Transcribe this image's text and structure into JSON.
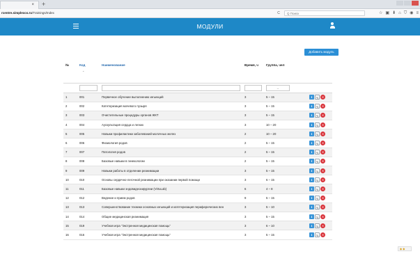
{
  "browser": {
    "tab_label": "",
    "tab_close": "×",
    "new_tab": "+",
    "url_host": "rcentre.simplexcs.ru",
    "url_path": "/Trainings/Index",
    "reload": "С",
    "search_placeholder": "Q Поиск",
    "toolbar_icons": [
      "star-icon",
      "clipboard-icon",
      "download-icon",
      "home-icon",
      "shield-icon",
      "circle-icon",
      "menu-icon"
    ]
  },
  "header": {
    "title": "МОДУЛИ",
    "menu_icon": "hamburger-icon",
    "user_icon": "user-icon"
  },
  "colors": {
    "header_bg": "#1e88c7",
    "button_bg": "#2b8fd6",
    "danger": "#d9353c",
    "link": "#2a6db0"
  },
  "add_button": {
    "label": "Добавить модуль"
  },
  "table": {
    "headers": {
      "num": "№",
      "code": "Код",
      "name": "Наименование",
      "hours": "Время, ч",
      "group": "Группа, чел"
    },
    "sort_caret": "⌄",
    "group_filter_value": "--",
    "action_buttons": [
      "ℹ",
      "✎",
      "✕"
    ],
    "rows": [
      {
        "num": "1",
        "code": "001",
        "name": "Первичное обучение выполнению инъекций",
        "hours": "3",
        "group": "5 – 15"
      },
      {
        "num": "2",
        "code": "002",
        "name": "Катетеризация мочевого пузыря",
        "hours": "3",
        "group": "5 – 15"
      },
      {
        "num": "3",
        "code": "003",
        "name": "Очистительные процедуры органов ЖКТ",
        "hours": "3",
        "group": "5 – 15"
      },
      {
        "num": "4",
        "code": "004",
        "name": "Аускультация сердца и легких",
        "hours": "3",
        "group": "10 – 20"
      },
      {
        "num": "5",
        "code": "005",
        "name": "Навыки профилактики заболеваний молочных желез",
        "hours": "2",
        "group": "10 – 20"
      },
      {
        "num": "6",
        "code": "006",
        "name": "Физиология родов",
        "hours": "2",
        "group": "5 – 15"
      },
      {
        "num": "7",
        "code": "007",
        "name": "Патология родов",
        "hours": "2",
        "group": "5 – 15"
      },
      {
        "num": "8",
        "code": "008",
        "name": "Базовые навыки в гинекологии",
        "hours": "2",
        "group": "5 – 15"
      },
      {
        "num": "9",
        "code": "009",
        "name": "Навыки работы в отделении реанимации",
        "hours": "3",
        "group": "5 – 15"
      },
      {
        "num": "10",
        "code": "010",
        "name": "Основы сердечно-легочной реанимации при оказании первой помощи",
        "hours": "3",
        "group": "6 – 15"
      },
      {
        "num": "11",
        "code": "011",
        "name": "Базовые навыки эндовидеохирургии (VirtuLab)",
        "hours": "6",
        "group": "4 – 8"
      },
      {
        "num": "12",
        "code": "012",
        "name": "Ведение и прием родов",
        "hours": "9",
        "group": "5 – 15"
      },
      {
        "num": "13",
        "code": "013",
        "name": "Совершенствование техники основных инъекций и катетеризация периферических вен",
        "hours": "3",
        "group": "5 – 10"
      },
      {
        "num": "14",
        "code": "014",
        "name": "Общие медицинская реанимация",
        "hours": "3",
        "group": "5 – 15"
      },
      {
        "num": "15",
        "code": "019",
        "name": "Учебная игра \"Экстренная медицинская помощь\"",
        "hours": "3",
        "group": "6 – 10"
      },
      {
        "num": "16",
        "code": "016",
        "name": "Учебная игра \"Экстренная медицинская помощь\"",
        "hours": "3",
        "group": "5 – 15"
      }
    ]
  }
}
